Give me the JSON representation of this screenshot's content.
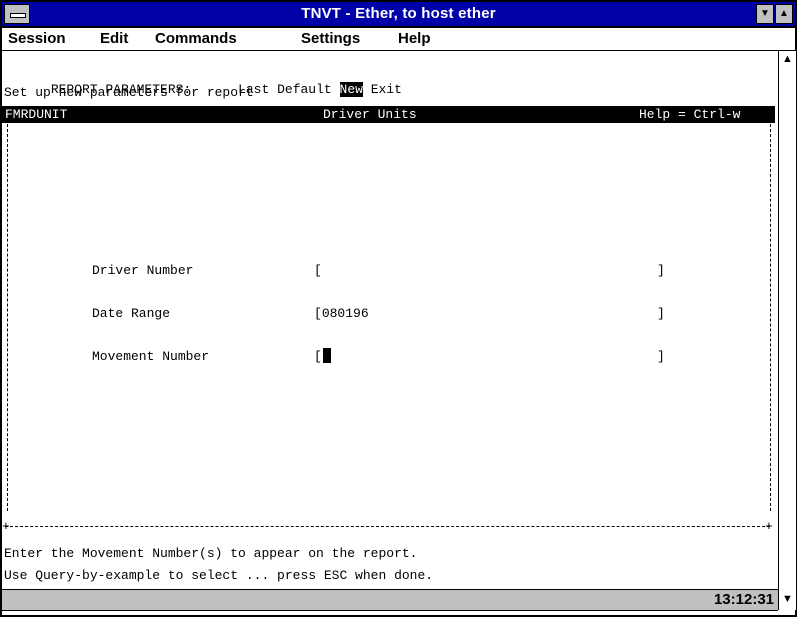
{
  "window": {
    "title": "TNVT - Ether, to host ether"
  },
  "menubar": {
    "items": [
      {
        "label": "Session"
      },
      {
        "label": "Edit"
      },
      {
        "label": "Commands"
      },
      {
        "label": "Settings"
      },
      {
        "label": "Help"
      }
    ]
  },
  "terminal": {
    "report_params_label": "REPORT PARAMETERS:",
    "options": {
      "last": "Last",
      "default": "Default",
      "new": "New",
      "exit": "Exit"
    },
    "subtitle": "Set up new parameters for report",
    "header": {
      "program": "FMRDUNIT",
      "screen_title": "Driver Units",
      "help": "Help = Ctrl-w"
    },
    "fields": [
      {
        "label": "Driver Number",
        "value": ""
      },
      {
        "label": "Date Range",
        "value": "080196"
      },
      {
        "label": "Movement Number",
        "value": ""
      }
    ],
    "footer_line1": "Enter the Movement Number(s) to appear on the report.",
    "footer_line2": "Use Query-by-example to select ... press ESC when done."
  },
  "status": {
    "time": "13:12:31"
  },
  "icons": {
    "system_menu": "system-menu-icon",
    "minimize": "minimize-icon",
    "maximize": "maximize-icon",
    "scroll_up": "scroll-up-icon",
    "scroll_down": "scroll-down-icon"
  }
}
